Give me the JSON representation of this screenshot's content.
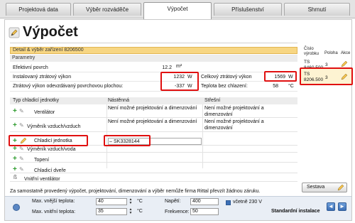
{
  "tabs": [
    "Projektová data",
    "Výběr rozváděče",
    "Výpočet",
    "Příslušenství",
    "Shrnutí"
  ],
  "active_tab_index": 2,
  "page_title": "Výpočet",
  "detail_bar": "Detail & výběr zařízení 8206500",
  "params_header": "Parametry",
  "params": {
    "effective_surface_label": "Efektivní povrch",
    "effective_surface_value": "12.2",
    "effective_surface_unit": "m²",
    "installed_loss_label": "Instalovaný ztrátový výkon",
    "installed_loss_value": "1232",
    "installed_loss_unit": "W",
    "total_loss_label": "Celkový ztrátový výkon",
    "total_loss_value": "1569",
    "total_loss_unit": "W",
    "surface_loss_label": "Ztrátový výkon odevzdávaný povrchovou plochou:",
    "surface_loss_value": "-337",
    "surface_loss_unit": "W",
    "temp_no_cooling_label": "Teplota bez chlazení:",
    "temp_no_cooling_value": "58",
    "temp_no_cooling_unit": "°C"
  },
  "right_table": {
    "headers": [
      "Číslo výrobku",
      "Poloha",
      "Akce"
    ],
    "rows": [
      {
        "product": "TS 8460.500",
        "position": "3"
      },
      {
        "product": "TS 8206.500",
        "position": "3"
      }
    ]
  },
  "units_table": {
    "headers": [
      "Typ chladicí jednotky",
      "Nástěnná",
      "Střešní"
    ],
    "rows": [
      {
        "name": "Ventilátor",
        "wall": "Není možné projektování a dimenzování",
        "roof": "Není možné projektování a dimenzování"
      },
      {
        "name": "Výměník vzduch/vzduch",
        "wall": "Není možné projektování a dimenzování",
        "roof": "Není možné projektování a dimenzování"
      },
      {
        "name": "Chladicí jednotka",
        "wall": "SK3328144",
        "roof": ""
      },
      {
        "name": "Výměník vzduch/voda",
        "wall": "",
        "roof": ""
      },
      {
        "name": "Topení",
        "wall": "",
        "roof": ""
      },
      {
        "name": "Chladicí dveře",
        "wall": "",
        "roof": ""
      },
      {
        "name": "Vnitřní ventilátor",
        "wall": "",
        "roof": ""
      }
    ]
  },
  "warning_text": "Za samostatně provedený výpočet, projektování, dimenzování a výběr nemůže firma Rittal převzít žádnou záruku.",
  "sestava_label": "Sestava",
  "bottom": {
    "max_outside_temp_label": "Max. vnější teplota:",
    "max_outside_temp_value": "40",
    "max_outside_temp_unit": "°C",
    "max_inside_temp_label": "Max. vnitřní teplota:",
    "max_inside_temp_value": "35",
    "max_inside_temp_unit": "°C",
    "voltage_label": "Napětí:",
    "voltage_value": "400",
    "frequency_label": "Frekvence:",
    "frequency_value": "50",
    "incl_230_label": "včetně 230 V",
    "standard_install_label": "Standardní instalace"
  },
  "colors": {
    "highlight_red": "#e01010",
    "detail_bar": "#f7d683",
    "plus_green": "#2e9b2e",
    "nav_blue": "#3c6fb5"
  }
}
